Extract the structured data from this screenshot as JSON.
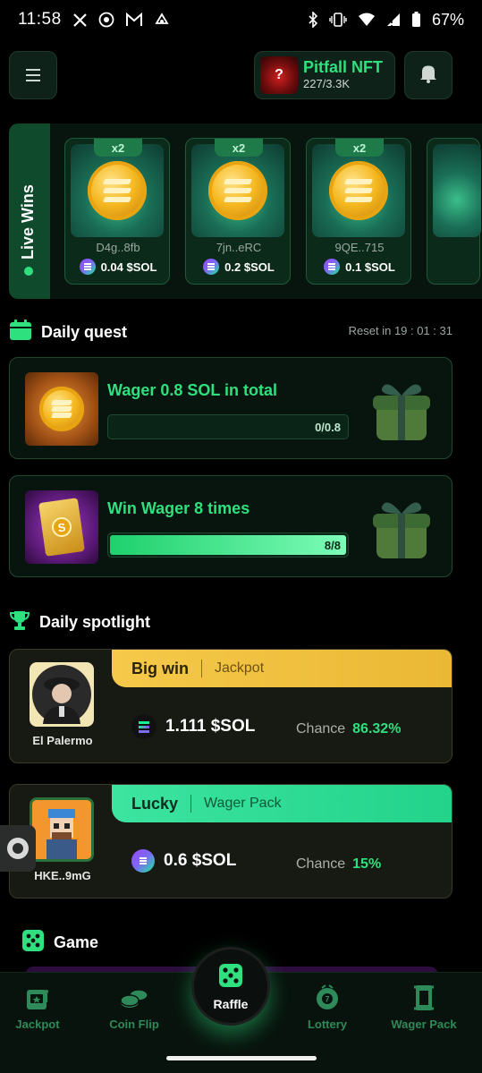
{
  "status_bar": {
    "time": "11:58",
    "battery": "67%",
    "left_icons": [
      "x-icon",
      "camera-icon",
      "gmail-icon",
      "sync-icon"
    ],
    "right_icons": [
      "bluetooth-icon",
      "vibrate-icon",
      "wifi-icon",
      "signal-icon",
      "battery-icon"
    ]
  },
  "header": {
    "nft_title": "Pitfall NFT",
    "nft_count": "227/3.3K",
    "nft_thumb_glyph": "?"
  },
  "live_wins": {
    "label": "Live Wins",
    "cards": [
      {
        "multiplier": "x2",
        "user": "D4g..8fb",
        "amount": "0.04 $SOL"
      },
      {
        "multiplier": "x2",
        "user": "7jn..eRC",
        "amount": "0.2 $SOL"
      },
      {
        "multiplier": "x2",
        "user": "9QE..715",
        "amount": "0.1 $SOL"
      }
    ]
  },
  "daily_quest": {
    "title": "Daily quest",
    "reset": "Reset in 19 : 01 : 31",
    "quests": [
      {
        "title": "Wager 0.8 SOL in total",
        "progress_text": "0/0.8",
        "progress": 0
      },
      {
        "title": "Win Wager 8 times",
        "progress_text": "8/8",
        "progress": 1
      }
    ]
  },
  "daily_spotlight": {
    "title": "Daily spotlight",
    "cards": [
      {
        "name": "El Palermo",
        "type": "Big win",
        "sub": "Jackpot",
        "amount": "1.111 $SOL",
        "chance_label": "Chance",
        "chance": "86.32%"
      },
      {
        "name": "HKE..9mG",
        "type": "Lucky",
        "sub": "Wager Pack",
        "amount": "0.6 $SOL",
        "chance_label": "Chance",
        "chance": "15%"
      }
    ]
  },
  "game": {
    "title": "Game"
  },
  "bottom_nav": {
    "items": [
      {
        "label": "Jackpot",
        "icon": "slot-machine-icon"
      },
      {
        "label": "Coin Flip",
        "icon": "coins-icon"
      },
      {
        "label": "Raffle",
        "icon": "dice-icon"
      },
      {
        "label": "Lottery",
        "icon": "lottery-ball-icon"
      },
      {
        "label": "Wager Pack",
        "icon": "card-pack-icon"
      }
    ]
  },
  "colors": {
    "accent": "#2ee07e",
    "gold_banner": "#f0c24a",
    "green_banner": "#2fe096",
    "background": "#000000"
  }
}
